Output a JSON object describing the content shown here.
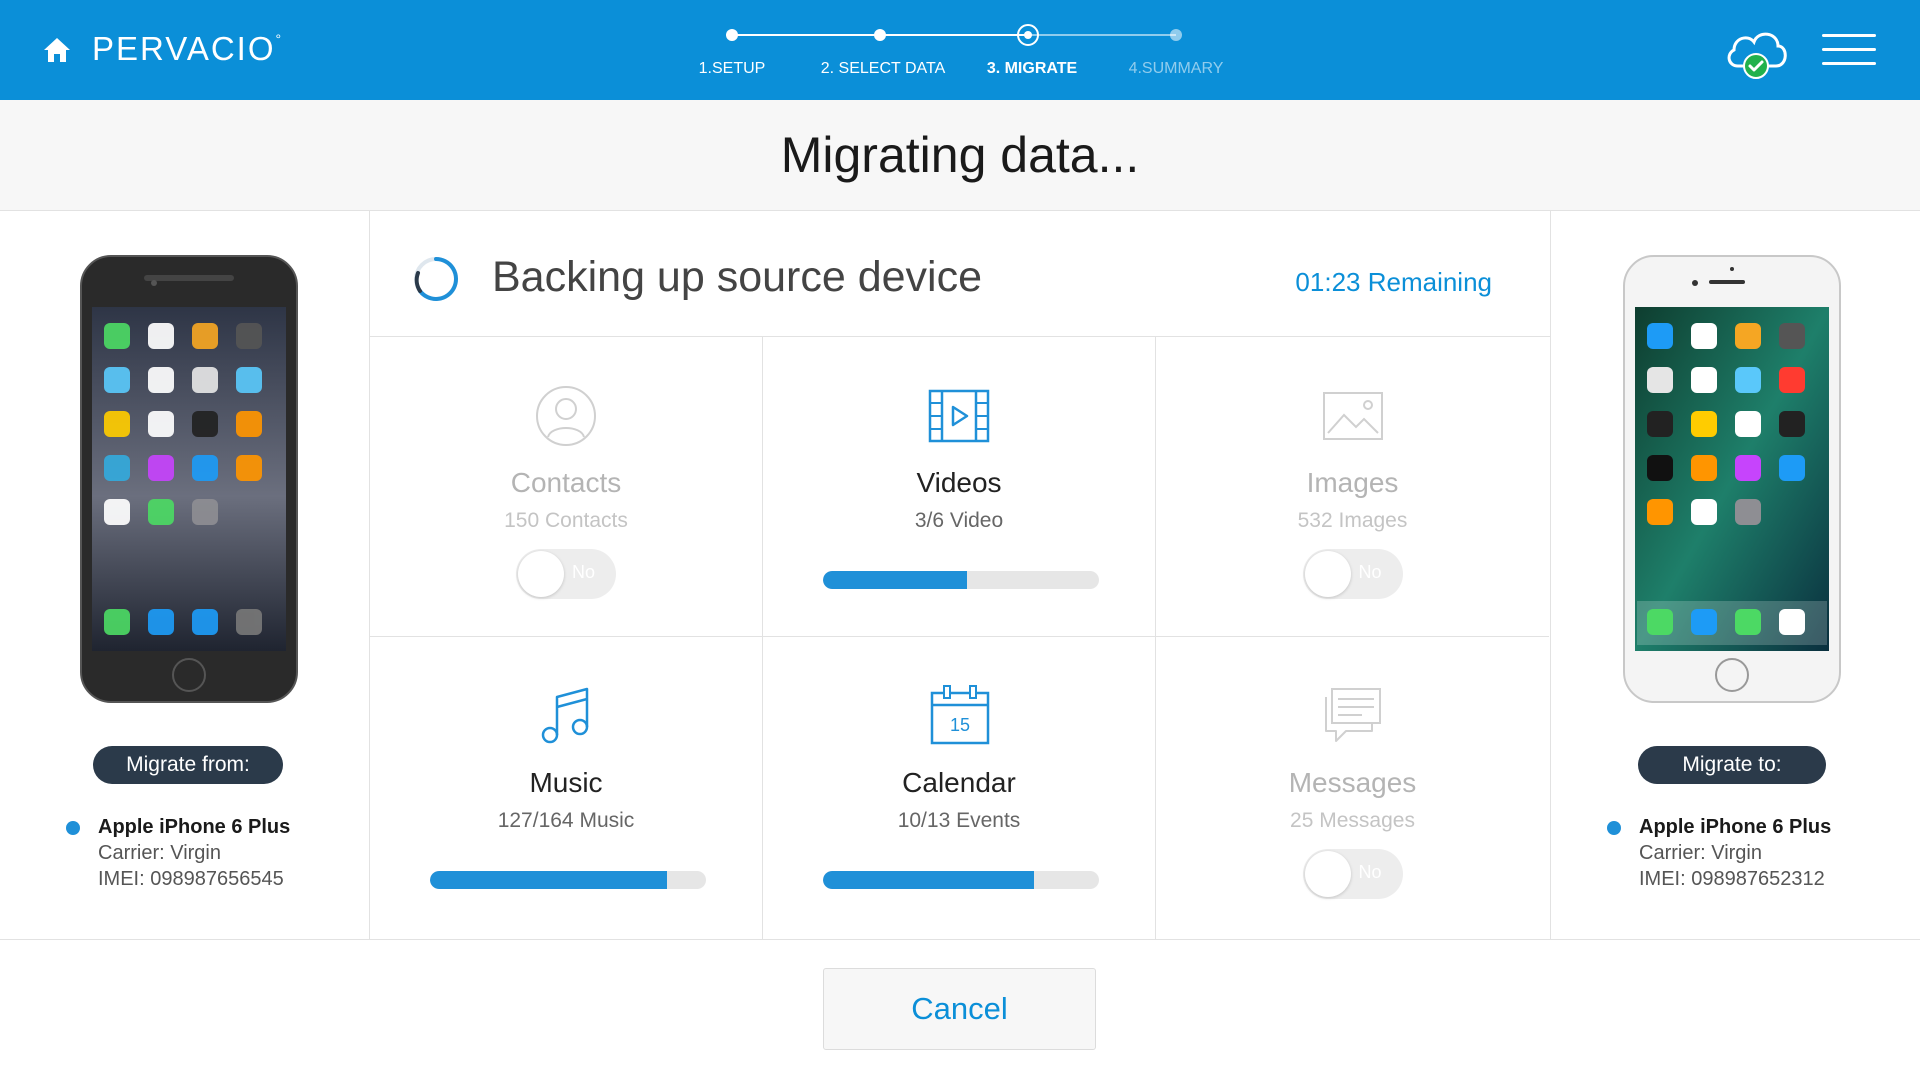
{
  "header": {
    "brand": "PERVACIO",
    "brand_mark": "°",
    "steps": [
      {
        "label": "1.SETUP",
        "state": "done"
      },
      {
        "label": "2. SELECT DATA",
        "state": "done"
      },
      {
        "label": "3. MIGRATE",
        "state": "current"
      },
      {
        "label": "4.SUMMARY",
        "state": "pending"
      }
    ],
    "icons": {
      "home": "home-icon",
      "cloud": "cloud-check-icon",
      "menu": "hamburger-menu-icon"
    }
  },
  "page": {
    "title": "Migrating data..."
  },
  "status": {
    "text": "Backing up source device",
    "remaining": "01:23 Remaining"
  },
  "categories": [
    {
      "name": "Contacts",
      "count": "150 Contacts",
      "enabled": false,
      "toggle_label": "No",
      "icon": "contacts-icon"
    },
    {
      "name": "Videos",
      "count": "3/6 Video",
      "enabled": true,
      "progress": 0.52,
      "icon": "video-icon"
    },
    {
      "name": "Images",
      "count": "532 Images",
      "enabled": false,
      "toggle_label": "No",
      "icon": "images-icon"
    },
    {
      "name": "Music",
      "count": "127/164 Music",
      "enabled": true,
      "progress": 0.86,
      "icon": "music-icon"
    },
    {
      "name": "Calendar",
      "count": "10/13 Events",
      "enabled": true,
      "progress": 0.765,
      "icon": "calendar-icon",
      "icon_text": "15"
    },
    {
      "name": "Messages",
      "count": "25 Messages",
      "enabled": false,
      "toggle_label": "No",
      "icon": "messages-icon"
    }
  ],
  "source": {
    "badge": "Migrate from:",
    "name": "Apple iPhone 6 Plus",
    "carrier": "Carrier: Virgin",
    "imei": "IMEI: 098987656545"
  },
  "target": {
    "badge": "Migrate to:",
    "name": "Apple iPhone 6 Plus",
    "carrier": "Carrier: Virgin",
    "imei": "IMEI: 098987652312"
  },
  "footer": {
    "cancel_label": "Cancel"
  },
  "colors": {
    "header": "#0b8fd8",
    "accent": "#1f90d8",
    "badge": "#2b3a4a"
  }
}
